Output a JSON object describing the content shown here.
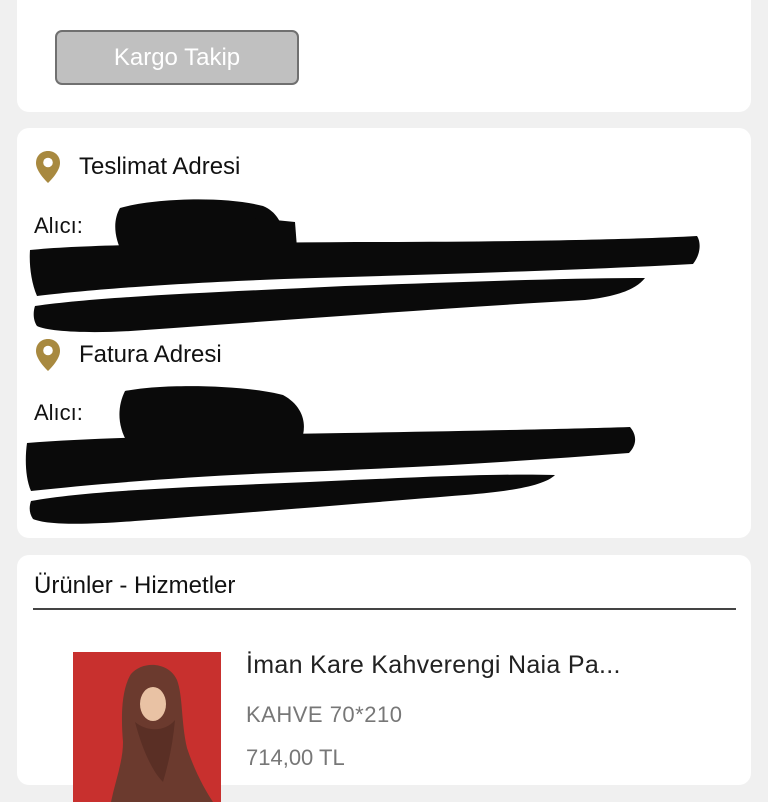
{
  "kargo": {
    "button_label": "Kargo Takip"
  },
  "addresses": {
    "delivery": {
      "title": "Teslimat Adresi",
      "recipient_label": "Alıcı:"
    },
    "billing": {
      "title": "Fatura Adresi",
      "recipient_label": "Alıcı:"
    },
    "pin_color": "#a8893f"
  },
  "products": {
    "section_title": "Ürünler - Hizmetler",
    "items": [
      {
        "name": "İman Kare Kahverengi Naia Pa...",
        "variant": "KAHVE 70*210",
        "price": "714,00 TL"
      }
    ]
  },
  "colors": {
    "page_bg": "#f0f0f0",
    "card_bg": "#ffffff",
    "button_bg": "#c0c0c0",
    "redaction": "#0a0a0a"
  }
}
